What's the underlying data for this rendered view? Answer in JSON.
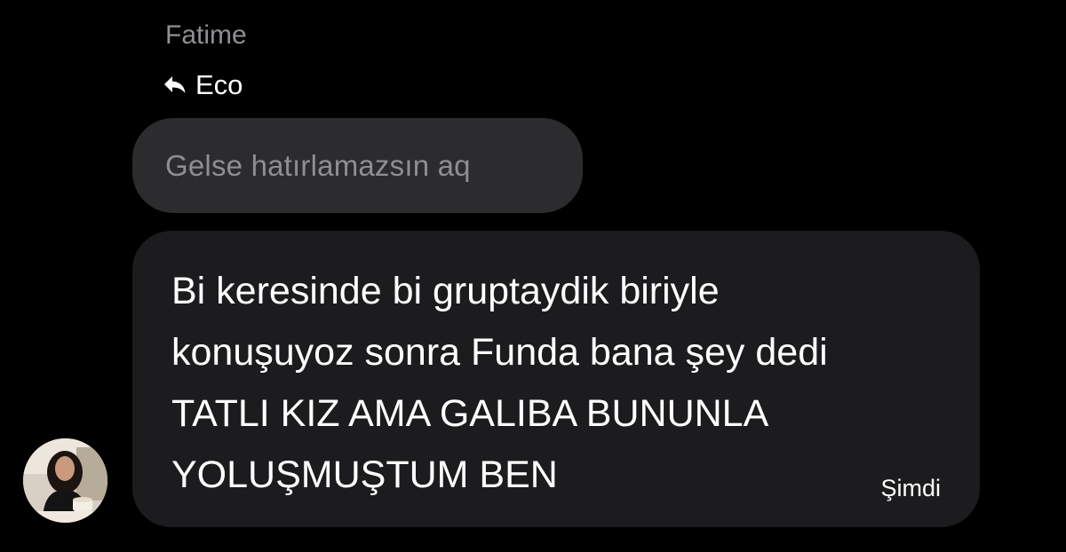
{
  "conversation": {
    "sender_name": "Fatime",
    "reply": {
      "icon": "reply-arrow-icon",
      "to_name": "Eco",
      "quoted_text": "Gelse hatırlamazsın aq"
    },
    "message": {
      "lines": [
        "Bi keresinde bi gruptaydik biriyle",
        "konuşuyoz sonra Funda bana şey dedi",
        "TATLI KIZ AMA GALIBA BUNUNLA",
        "YOLUŞMUŞTUM BEN"
      ],
      "timestamp": "Şimdi"
    },
    "avatar": {
      "icon": "profile-photo"
    }
  },
  "colors": {
    "background": "#000000",
    "quoted_bubble": "#2c2c2e",
    "message_bubble": "#1c1c1e",
    "secondary_text": "#8e8e93",
    "primary_text": "#ffffff"
  }
}
